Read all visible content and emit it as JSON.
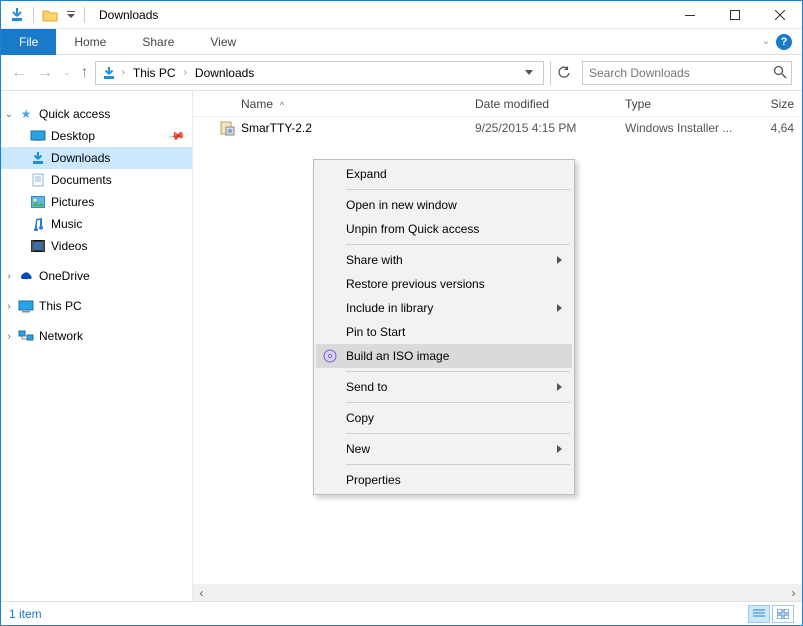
{
  "window": {
    "title": "Downloads"
  },
  "ribbon": {
    "file": "File",
    "tabs": [
      "Home",
      "Share",
      "View"
    ]
  },
  "nav": {
    "breadcrumb": [
      {
        "label": "This PC"
      },
      {
        "label": "Downloads"
      }
    ],
    "search_placeholder": "Search Downloads"
  },
  "sidebar": {
    "quick_access": {
      "label": "Quick access",
      "items": [
        {
          "label": "Desktop",
          "icon": "desktop",
          "pinned": true
        },
        {
          "label": "Downloads",
          "icon": "downloads",
          "pinned": true,
          "selected": true
        },
        {
          "label": "Documents",
          "icon": "documents",
          "pinned": true
        },
        {
          "label": "Pictures",
          "icon": "pictures",
          "pinned": true
        },
        {
          "label": "Music",
          "icon": "music",
          "pinned": false
        },
        {
          "label": "Videos",
          "icon": "videos",
          "pinned": false
        }
      ]
    },
    "onedrive": {
      "label": "OneDrive"
    },
    "thispc": {
      "label": "This PC"
    },
    "network": {
      "label": "Network"
    }
  },
  "content": {
    "columns": {
      "name": "Name",
      "date": "Date modified",
      "type": "Type",
      "size": "Size"
    },
    "rows": [
      {
        "name": "SmarTTY-2.2",
        "date": "9/25/2015 4:15 PM",
        "type": "Windows Installer ...",
        "size": "4,64"
      }
    ]
  },
  "context_menu": {
    "items": [
      {
        "label": "Expand"
      },
      {
        "sep": true
      },
      {
        "label": "Open in new window"
      },
      {
        "label": "Unpin from Quick access"
      },
      {
        "sep": true
      },
      {
        "label": "Share with",
        "submenu": true
      },
      {
        "label": "Restore previous versions"
      },
      {
        "label": "Include in library",
        "submenu": true
      },
      {
        "label": "Pin to Start"
      },
      {
        "label": "Build an ISO image",
        "icon": "iso",
        "highlight": true
      },
      {
        "sep": true
      },
      {
        "label": "Send to",
        "submenu": true
      },
      {
        "sep": true
      },
      {
        "label": "Copy"
      },
      {
        "sep": true
      },
      {
        "label": "New",
        "submenu": true
      },
      {
        "sep": true
      },
      {
        "label": "Properties"
      }
    ]
  },
  "status": {
    "item_count": "1 item"
  }
}
